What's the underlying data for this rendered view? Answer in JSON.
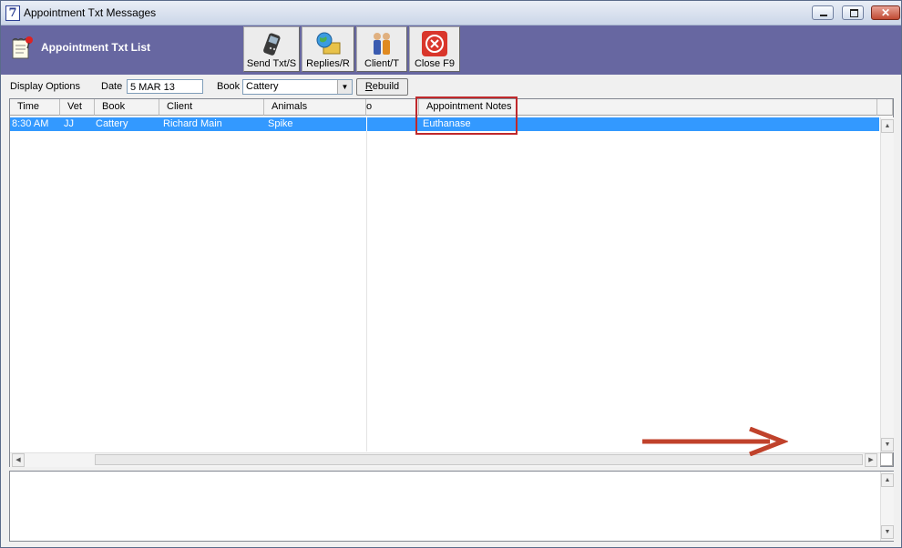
{
  "window": {
    "app_icon_glyph": "7",
    "title": "Appointment Txt Messages",
    "controls": {
      "minimize": "minimize-icon",
      "maximize": "maximize-icon",
      "close": "close-icon"
    }
  },
  "header": {
    "title": "Appointment Txt List",
    "toolbar": [
      {
        "label": "Send Txt/S",
        "icon": "mobile-phone-icon"
      },
      {
        "label": "Replies/R",
        "icon": "globe-folder-icon"
      },
      {
        "label": "Client/T",
        "icon": "people-icon"
      },
      {
        "label": "Close F9",
        "icon": "close-circle-icon"
      }
    ]
  },
  "options": {
    "display_options_label": "Display Options",
    "date_label": "Date",
    "date_value": "5 MAR 13",
    "book_label": "Book",
    "book_value": "Cattery",
    "rebuild_label_underlined": "R",
    "rebuild_label_rest": "ebuild"
  },
  "grid": {
    "columns": [
      "Time",
      "Vet",
      "Book",
      "Client",
      "Animals",
      "o",
      "Appointment Notes"
    ],
    "rows": [
      {
        "time": "8:30 AM",
        "vet": "JJ",
        "book": "Cattery",
        "client": "Richard Main",
        "animals": "Spike",
        "o": "",
        "notes": "Euthanase"
      }
    ],
    "selected_row_color": "#3399ff"
  },
  "annotations": {
    "highlight_color": "#c0282b",
    "arrow_color": "#c0422b"
  }
}
